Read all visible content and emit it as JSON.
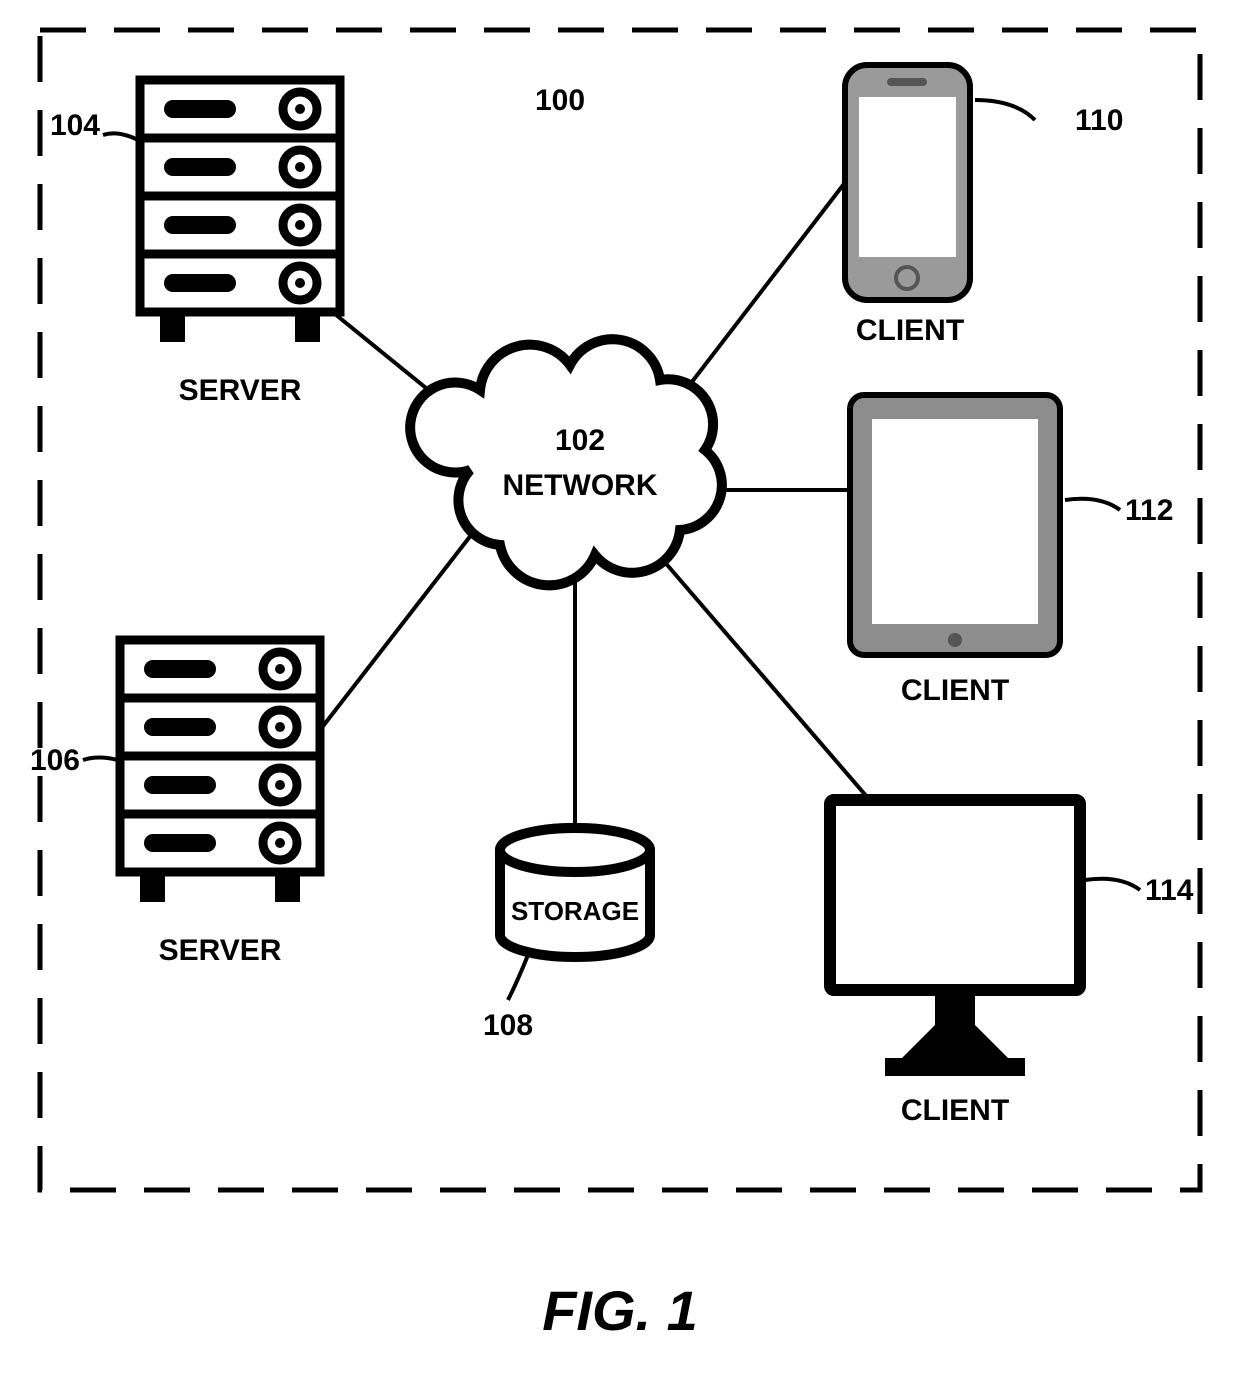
{
  "figure": {
    "caption": "FIG. 1",
    "system_ref": "100"
  },
  "network": {
    "ref": "102",
    "label": "NETWORK"
  },
  "storage": {
    "ref": "108",
    "label": "STORAGE"
  },
  "servers": [
    {
      "ref": "104",
      "label": "SERVER"
    },
    {
      "ref": "106",
      "label": "SERVER"
    }
  ],
  "clients": [
    {
      "ref": "110",
      "label": "CLIENT",
      "device": "phone"
    },
    {
      "ref": "112",
      "label": "CLIENT",
      "device": "tablet"
    },
    {
      "ref": "114",
      "label": "CLIENT",
      "device": "desktop"
    }
  ]
}
